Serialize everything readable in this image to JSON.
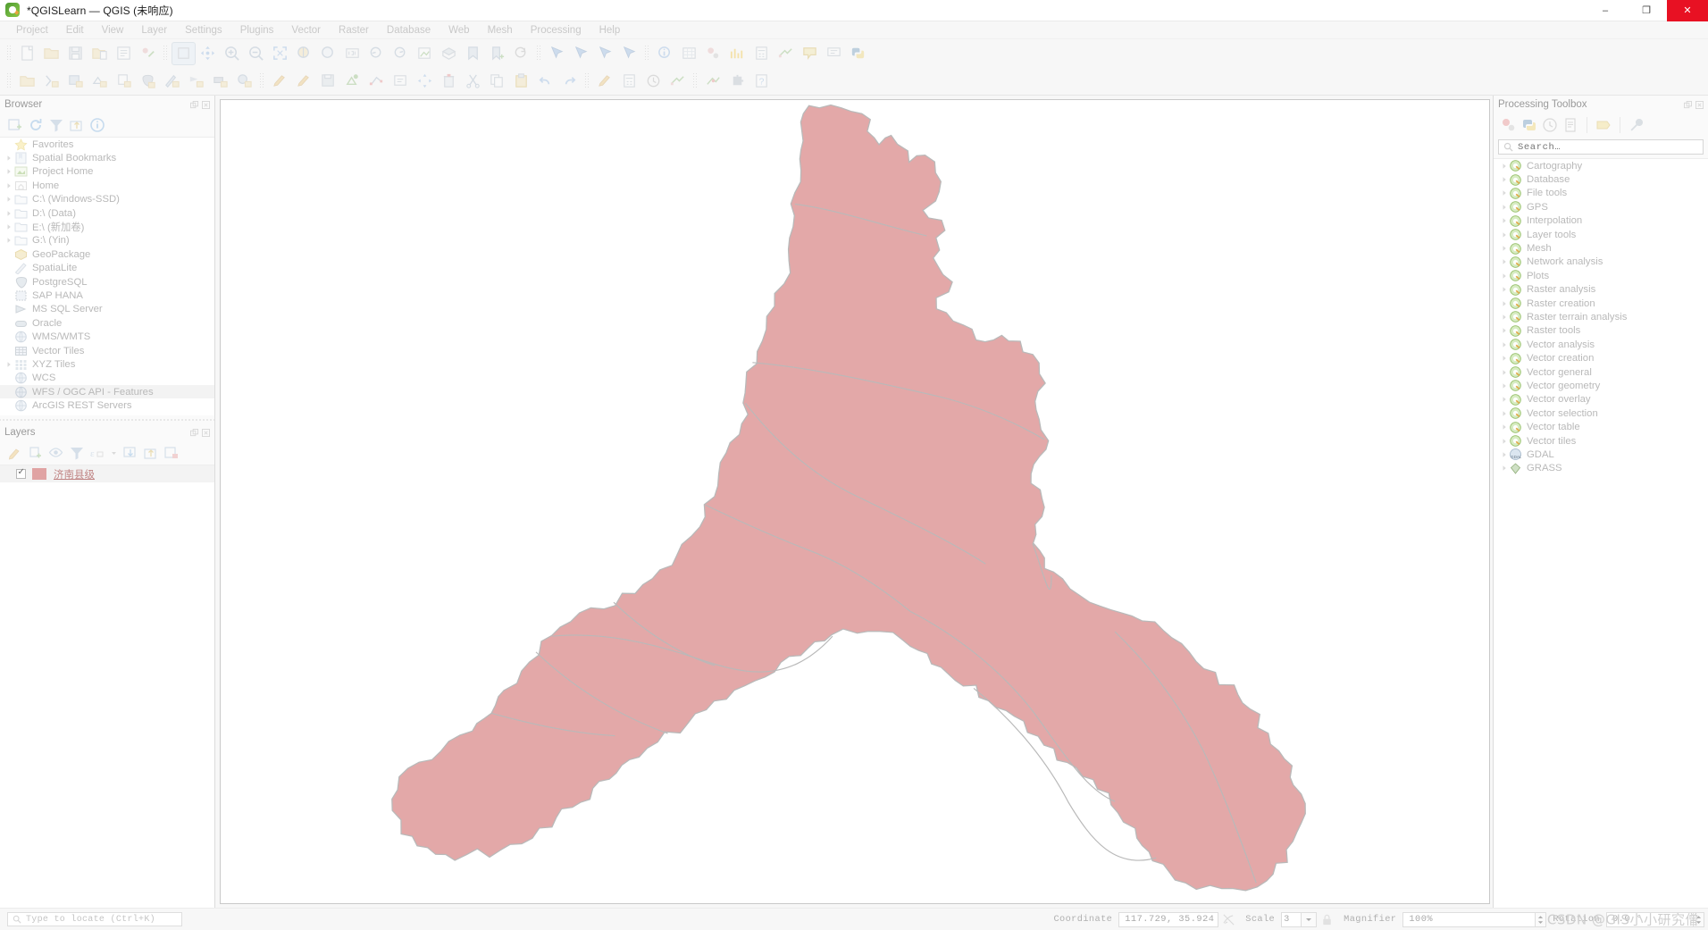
{
  "window": {
    "title": "*QGISLearn — QGIS (未响应)",
    "logo_icon": "qgis-logo-icon",
    "controls": {
      "minimize": "–",
      "maximize": "❐",
      "close": "✕"
    }
  },
  "menubar": {
    "items": [
      "Project",
      "Edit",
      "View",
      "Layer",
      "Settings",
      "Plugins",
      "Vector",
      "Raster",
      "Database",
      "Web",
      "Mesh",
      "Processing",
      "Help"
    ]
  },
  "toolbars": {
    "row1": [
      {
        "name": "new-project-icon"
      },
      {
        "name": "open-project-icon"
      },
      {
        "name": "save-project-icon"
      },
      {
        "name": "save-project-as-icon"
      },
      {
        "name": "new-print-layout-icon"
      },
      {
        "name": "style-manager-icon"
      },
      {
        "sep": true
      },
      {
        "name": "pan-map-icon",
        "active": true
      },
      {
        "name": "pan-to-selection-icon"
      },
      {
        "name": "zoom-in-icon"
      },
      {
        "name": "zoom-out-icon"
      },
      {
        "name": "zoom-full-icon"
      },
      {
        "name": "zoom-to-selection-icon"
      },
      {
        "name": "zoom-to-layer-icon"
      },
      {
        "name": "zoom-native-icon"
      },
      {
        "name": "zoom-last-icon"
      },
      {
        "name": "zoom-next-icon"
      },
      {
        "name": "new-map-view-icon"
      },
      {
        "name": "new-3d-map-view-icon"
      },
      {
        "name": "show-bookmarks-icon"
      },
      {
        "name": "new-bookmark-icon"
      },
      {
        "name": "refresh-icon"
      },
      {
        "sep": true
      },
      {
        "name": "select-features-icon"
      },
      {
        "name": "select-by-value-icon"
      },
      {
        "name": "deselect-features-icon"
      },
      {
        "name": "select-by-expression-icon"
      },
      {
        "sep": true
      },
      {
        "name": "identify-features-icon"
      },
      {
        "name": "open-attribute-table-icon"
      },
      {
        "name": "processing-toolbox-icon"
      },
      {
        "name": "statistical-summary-icon"
      },
      {
        "name": "field-calculator-icon"
      },
      {
        "name": "measure-line-icon"
      },
      {
        "name": "show-map-tips-icon"
      },
      {
        "name": "text-annotation-icon"
      },
      {
        "name": "python-console-icon"
      }
    ],
    "row2": [
      {
        "name": "open-data-source-manager-icon"
      },
      {
        "name": "add-vector-layer-icon"
      },
      {
        "name": "add-raster-layer-icon"
      },
      {
        "name": "add-mesh-layer-icon"
      },
      {
        "name": "add-delimited-text-layer-icon"
      },
      {
        "name": "add-postgis-layer-icon"
      },
      {
        "name": "add-spatialite-layer-icon"
      },
      {
        "name": "add-mssql-layer-icon"
      },
      {
        "name": "add-oracle-layer-icon"
      },
      {
        "name": "add-wms-layer-icon"
      },
      {
        "sep": true
      },
      {
        "name": "current-edits-icon"
      },
      {
        "name": "toggle-editing-icon"
      },
      {
        "name": "save-layer-edits-icon"
      },
      {
        "name": "add-feature-icon"
      },
      {
        "name": "vertex-tool-icon"
      },
      {
        "name": "modify-attributes-icon"
      },
      {
        "name": "move-feature-icon"
      },
      {
        "name": "delete-selected-icon"
      },
      {
        "name": "cut-features-icon"
      },
      {
        "name": "copy-features-icon"
      },
      {
        "name": "paste-features-icon"
      },
      {
        "name": "undo-icon"
      },
      {
        "name": "redo-icon"
      },
      {
        "sep": true
      },
      {
        "name": "layer-styling-panel-icon"
      },
      {
        "name": "open-field-calculator-icon"
      },
      {
        "name": "temporal-controller-icon"
      },
      {
        "name": "measure-area-icon"
      },
      {
        "sep": true
      },
      {
        "name": "georeferencer-icon"
      },
      {
        "name": "plugin-manager-icon"
      },
      {
        "name": "help-contents-icon"
      }
    ]
  },
  "browser": {
    "title": "Browser",
    "panel_buttons": [
      "float-panel-icon",
      "close-panel-icon"
    ],
    "toolbar": [
      "add-layer-icon",
      "refresh-icon",
      "filter-browser-icon",
      "collapse-all-icon",
      "enable-properties-widget-icon"
    ],
    "items": [
      {
        "label": "Favorites",
        "icon": "star-icon",
        "expandable": false
      },
      {
        "label": "Spatial Bookmarks",
        "icon": "bookmark-icon",
        "expandable": true
      },
      {
        "label": "Project Home",
        "icon": "project-home-icon",
        "expandable": true
      },
      {
        "label": "Home",
        "icon": "home-icon",
        "expandable": true
      },
      {
        "label": "C:\\ (Windows-SSD)",
        "icon": "drive-folder-icon",
        "expandable": true
      },
      {
        "label": "D:\\ (Data)",
        "icon": "drive-folder-icon",
        "expandable": true
      },
      {
        "label": "E:\\ (新加卷)",
        "icon": "drive-folder-icon",
        "expandable": true
      },
      {
        "label": "G:\\ (Yin)",
        "icon": "drive-folder-icon",
        "expandable": true
      },
      {
        "label": "GeoPackage",
        "icon": "geopackage-icon",
        "expandable": false
      },
      {
        "label": "SpatiaLite",
        "icon": "spatialite-icon",
        "expandable": false
      },
      {
        "label": "PostgreSQL",
        "icon": "postgresql-icon",
        "expandable": false
      },
      {
        "label": "SAP HANA",
        "icon": "sap-hana-icon",
        "expandable": false
      },
      {
        "label": "MS SQL Server",
        "icon": "mssql-icon",
        "expandable": false
      },
      {
        "label": "Oracle",
        "icon": "oracle-icon",
        "expandable": false
      },
      {
        "label": "WMS/WMTS",
        "icon": "wms-globe-icon",
        "expandable": false
      },
      {
        "label": "Vector Tiles",
        "icon": "vector-tiles-icon",
        "expandable": false
      },
      {
        "label": "XYZ Tiles",
        "icon": "xyz-tiles-icon",
        "expandable": true
      },
      {
        "label": "WCS",
        "icon": "wcs-globe-icon",
        "expandable": false
      },
      {
        "label": "WFS / OGC API - Features",
        "icon": "wfs-globe-icon",
        "expandable": false,
        "selected": true
      },
      {
        "label": "ArcGIS REST Servers",
        "icon": "arcgis-globe-icon",
        "expandable": false
      }
    ]
  },
  "layers": {
    "title": "Layers",
    "panel_buttons": [
      "float-panel-icon",
      "close-panel-icon"
    ],
    "toolbar": [
      "open-layer-styling-icon",
      "add-group-icon",
      "manage-visibility-icon",
      "filter-legend-icon",
      "filter-legend-expression-icon",
      "expand-all-icon",
      "collapse-all-icon",
      "remove-layer-icon"
    ],
    "items": [
      {
        "label": "济南县级",
        "checked": true,
        "swatch_color": "#e0a3a3",
        "selected": true
      }
    ]
  },
  "processing_toolbox": {
    "title": "Processing Toolbox",
    "panel_buttons": [
      "float-panel-icon",
      "close-panel-icon"
    ],
    "toolbar": [
      "models-icon",
      "scripts-icon",
      "history-icon",
      "results-viewer-icon",
      "edit-rendering-styles-icon",
      "options-icon"
    ],
    "search": {
      "placeholder": "Search…",
      "value": "",
      "icon": "search-icon"
    },
    "providers": [
      {
        "label": "Cartography",
        "icon": "qgis-provider-icon"
      },
      {
        "label": "Database",
        "icon": "qgis-provider-icon"
      },
      {
        "label": "File tools",
        "icon": "qgis-provider-icon"
      },
      {
        "label": "GPS",
        "icon": "qgis-provider-icon"
      },
      {
        "label": "Interpolation",
        "icon": "qgis-provider-icon"
      },
      {
        "label": "Layer tools",
        "icon": "qgis-provider-icon"
      },
      {
        "label": "Mesh",
        "icon": "qgis-provider-icon"
      },
      {
        "label": "Network analysis",
        "icon": "qgis-provider-icon"
      },
      {
        "label": "Plots",
        "icon": "qgis-provider-icon"
      },
      {
        "label": "Raster analysis",
        "icon": "qgis-provider-icon"
      },
      {
        "label": "Raster creation",
        "icon": "qgis-provider-icon"
      },
      {
        "label": "Raster terrain analysis",
        "icon": "qgis-provider-icon"
      },
      {
        "label": "Raster tools",
        "icon": "qgis-provider-icon"
      },
      {
        "label": "Vector analysis",
        "icon": "qgis-provider-icon"
      },
      {
        "label": "Vector creation",
        "icon": "qgis-provider-icon"
      },
      {
        "label": "Vector general",
        "icon": "qgis-provider-icon"
      },
      {
        "label": "Vector geometry",
        "icon": "qgis-provider-icon"
      },
      {
        "label": "Vector overlay",
        "icon": "qgis-provider-icon"
      },
      {
        "label": "Vector selection",
        "icon": "qgis-provider-icon"
      },
      {
        "label": "Vector table",
        "icon": "qgis-provider-icon"
      },
      {
        "label": "Vector tiles",
        "icon": "qgis-provider-icon"
      },
      {
        "label": "GDAL",
        "icon": "gdal-provider-icon"
      },
      {
        "label": "GRASS",
        "icon": "grass-provider-icon"
      }
    ]
  },
  "map": {
    "layer_fill": "#e3a8a8",
    "layer_stroke": "#b9b9b9",
    "background": "#ffffff"
  },
  "statusbar": {
    "locator": {
      "placeholder": "Type to locate (Ctrl+K)",
      "value": "",
      "icon": "search-icon"
    },
    "coordinate_label": "Coordinate",
    "coordinate_value": "117.729,  35.924",
    "toggle_extents_icon": "toggle-extents-icon",
    "scale_label": "Scale",
    "scale_value": "3",
    "lock_scale_icon": "lock-icon",
    "magnifier_label": "Magnifier",
    "magnifier_value": "100%",
    "rotation_label": "Rotation",
    "rotation_value": "0.0 °",
    "watermark": "CSDN @GIS小小研究僧"
  }
}
